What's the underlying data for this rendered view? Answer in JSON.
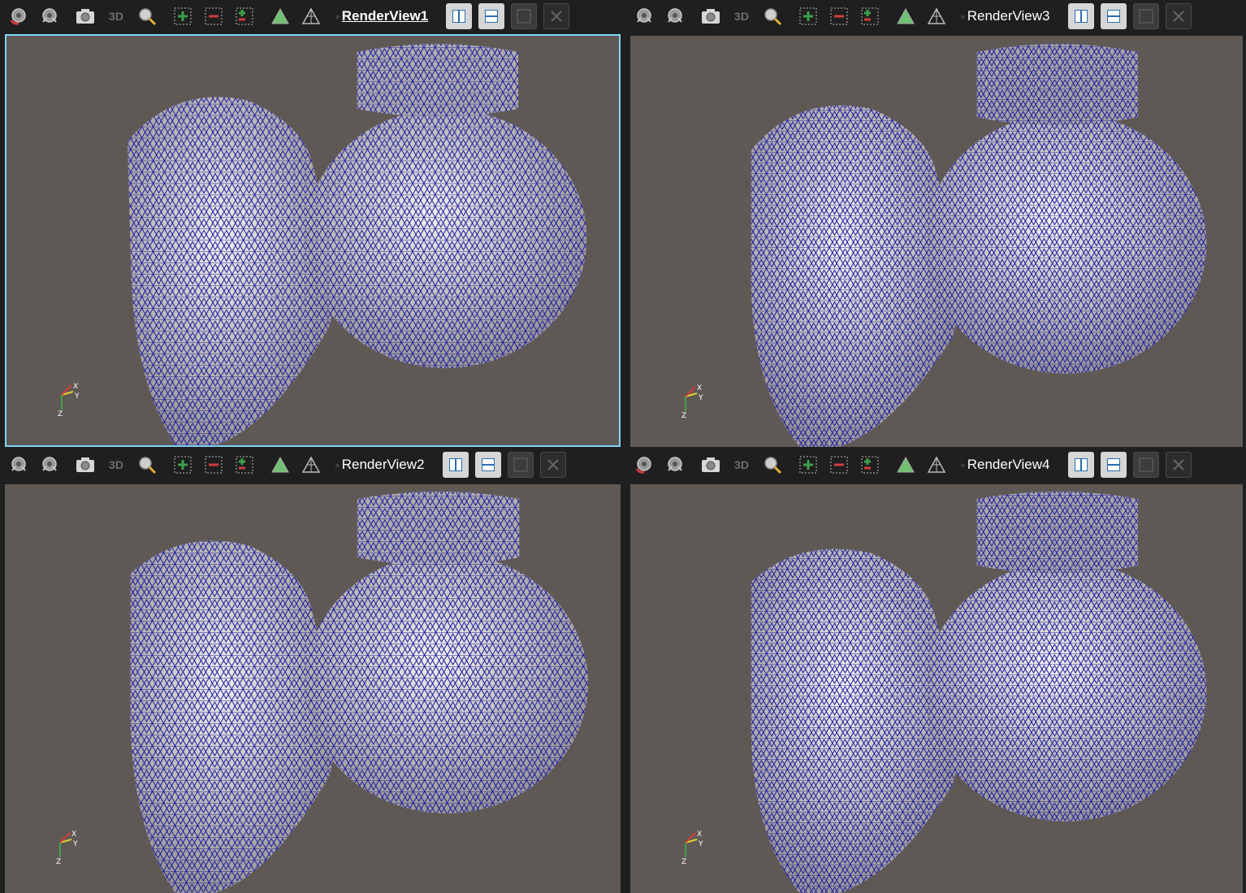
{
  "views": [
    {
      "id": "p1",
      "title": "RenderView1",
      "active": true,
      "reset_icon_variant": "red"
    },
    {
      "id": "p3",
      "title": "RenderView3",
      "active": false,
      "reset_icon_variant": "gray"
    },
    {
      "id": "p2",
      "title": "RenderView2",
      "active": false,
      "reset_icon_variant": "gray"
    },
    {
      "id": "p4",
      "title": "RenderView4",
      "active": false,
      "reset_icon_variant": "red"
    }
  ],
  "toolbar": {
    "mode_label": "3D",
    "chevron": "»",
    "axes": {
      "x": "X",
      "y": "Y",
      "z": "Z"
    }
  },
  "colors": {
    "background": "#5f5956",
    "mesh_wire": "#1a1aa0",
    "surface": "#e8e4e2",
    "active_border": "#7ed4f2",
    "toolbar_bg": "#1f1f1f"
  }
}
